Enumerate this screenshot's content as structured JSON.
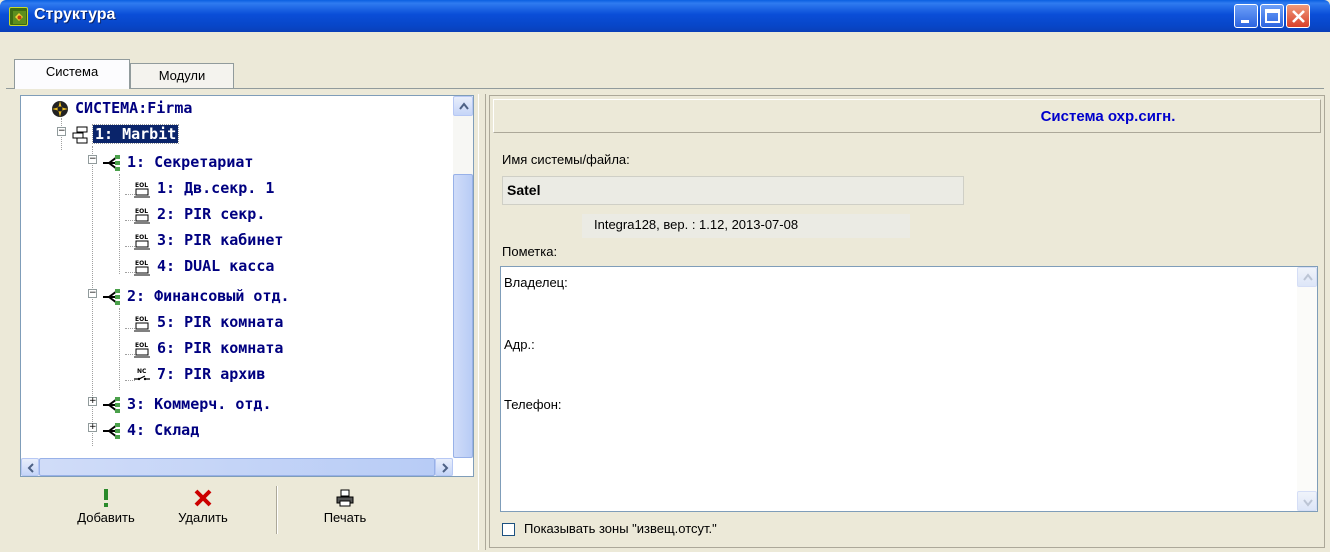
{
  "window": {
    "title": "Структура"
  },
  "tabs": [
    {
      "label": "Система",
      "active": true
    },
    {
      "label": "Модули",
      "active": false
    }
  ],
  "tree": {
    "root": "СИСТЕМА:Firma",
    "items": [
      {
        "label": "1:  Marbit",
        "kind": "partition-group",
        "selected": true,
        "expanded": true
      },
      {
        "label": "1: Секретариат",
        "kind": "partition",
        "expanded": true
      },
      {
        "label": "1: Дв.секр.  1",
        "kind": "zone-eol"
      },
      {
        "label": "2: PIR секр.",
        "kind": "zone-eol"
      },
      {
        "label": "3: PIR кабинет",
        "kind": "zone-eol"
      },
      {
        "label": "4: DUAL касса",
        "kind": "zone-eol"
      },
      {
        "label": "2: Финансовый отд.",
        "kind": "partition",
        "expanded": true
      },
      {
        "label": "5: PIR комната",
        "kind": "zone-eol"
      },
      {
        "label": "6: PIR комната",
        "kind": "zone-eol"
      },
      {
        "label": "7: PIR архив",
        "kind": "zone-nc"
      },
      {
        "label": "3: Коммерч. отд.",
        "kind": "partition",
        "expanded": false
      },
      {
        "label": "4: Склад",
        "kind": "partition",
        "expanded": false
      }
    ]
  },
  "toolbar": {
    "add_label": "Добавить",
    "delete_label": "Удалить",
    "print_label": "Печать"
  },
  "details": {
    "header": "Система охр.сигн.",
    "name_label": "Имя системы/файла:",
    "name_value": "Satel",
    "version": "Integra128, вер. : 1.12,  2013-07-08",
    "note_label": "Пометка:",
    "note_lines": [
      "Владелец:",
      "Адр.:",
      "Телефон:"
    ],
    "checkbox_label": "Показывать зоны \"извещ.отсут.\"",
    "checkbox_checked": false
  },
  "colors": {
    "titlebar": "#0a4ed8",
    "tree_text": "#000080",
    "selection": "#0a246a",
    "header_text": "#0000cc",
    "delete_icon": "#cc0000",
    "add_icon": "#2a8a2a"
  }
}
